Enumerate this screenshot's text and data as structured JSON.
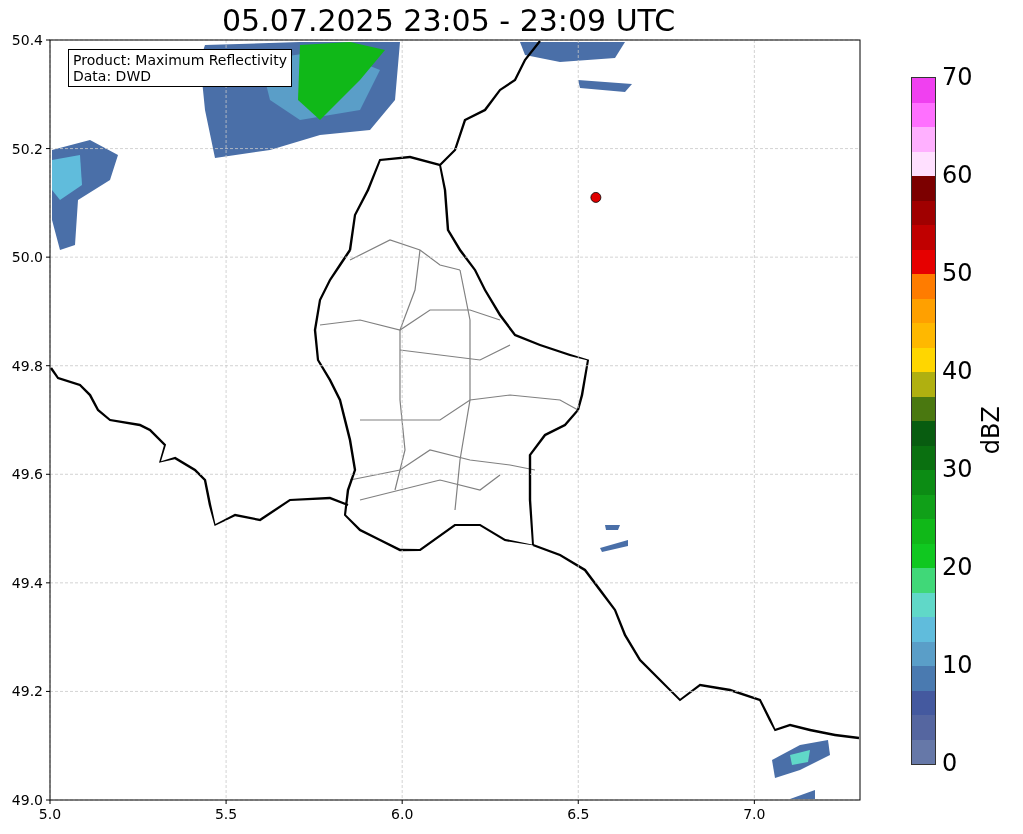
{
  "map": {
    "chart_data": {
      "type": "scatter",
      "title": "05.07.2025 23:05 - 23:09 UTC",
      "grid": true,
      "xlim": [
        5.0,
        7.3
      ],
      "ylim": [
        49.0,
        50.4
      ],
      "xticks": [
        {
          "value": 5.0,
          "label": "5.0"
        },
        {
          "value": 5.5,
          "label": "5.5"
        },
        {
          "value": 6.0,
          "label": "6.0"
        },
        {
          "value": 6.5,
          "label": "6.5"
        },
        {
          "value": 7.0,
          "label": "7.0"
        }
      ],
      "yticks": [
        {
          "value": 49.0,
          "label": "49.0"
        },
        {
          "value": 49.2,
          "label": "49.2"
        },
        {
          "value": 49.4,
          "label": "49.4"
        },
        {
          "value": 49.6,
          "label": "49.6"
        },
        {
          "value": 49.8,
          "label": "49.8"
        },
        {
          "value": 50.0,
          "label": "50.0"
        },
        {
          "value": 50.2,
          "label": "50.2"
        },
        {
          "value": 50.4,
          "label": "50.4"
        }
      ],
      "x": [
        6.55
      ],
      "series": [
        {
          "color": "#e00000",
          "values": [
            50.11
          ]
        }
      ]
    }
  },
  "info_box": {
    "lines": [
      "Product: Maximum Reflectivity",
      "Data: DWD"
    ]
  },
  "colorbar": {
    "label": "dBZ",
    "ticks": [
      "70",
      "60",
      "50",
      "40",
      "30",
      "20",
      "10",
      "0"
    ]
  }
}
